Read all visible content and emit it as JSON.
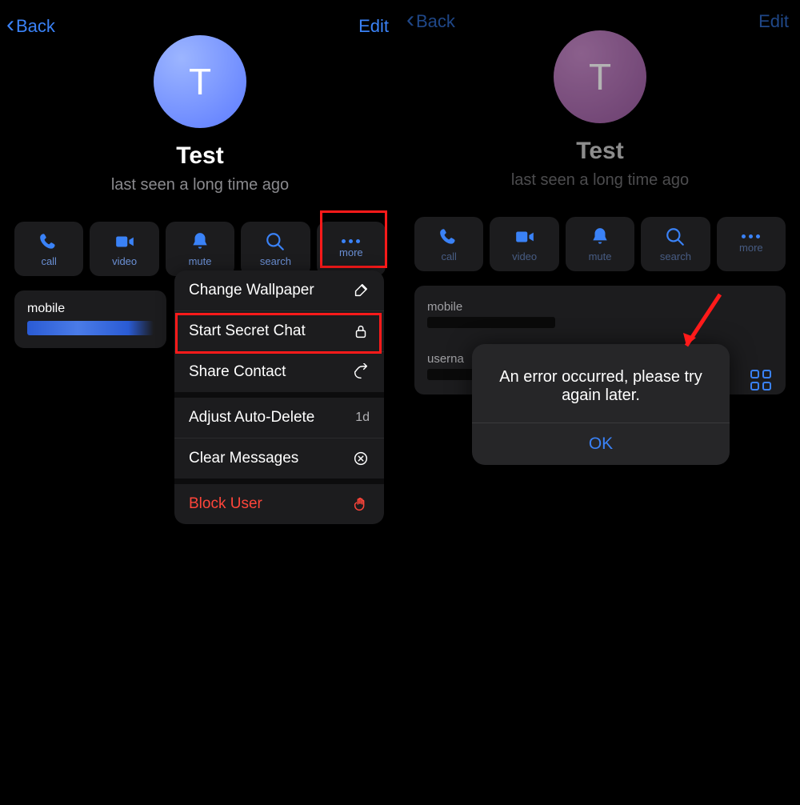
{
  "left": {
    "nav": {
      "back": "Back",
      "edit": "Edit"
    },
    "profile": {
      "initial": "T",
      "name": "Test",
      "status": "last seen a long time ago"
    },
    "actions": {
      "call": "call",
      "video": "video",
      "mute": "mute",
      "search": "search",
      "more": "more"
    },
    "info": {
      "mobile_label": "mobile"
    },
    "menu": {
      "change_wallpaper": "Change Wallpaper",
      "start_secret_chat": "Start Secret Chat",
      "share_contact": "Share Contact",
      "adjust_auto_delete": "Adjust Auto-Delete",
      "auto_delete_value": "1d",
      "clear_messages": "Clear Messages",
      "block_user": "Block User"
    }
  },
  "right": {
    "nav": {
      "back": "Back",
      "edit": "Edit"
    },
    "profile": {
      "initial": "T",
      "name": "Test",
      "status": "last seen a long time ago"
    },
    "actions": {
      "call": "call",
      "video": "video",
      "mute": "mute",
      "search": "search",
      "more": "more"
    },
    "info": {
      "mobile_label": "mobile",
      "username_label": "userna"
    },
    "dialog": {
      "message": "An error occurred, please try again later.",
      "ok": "OK"
    }
  }
}
